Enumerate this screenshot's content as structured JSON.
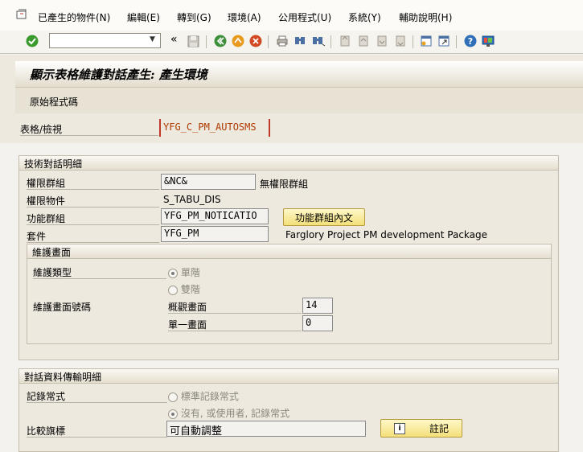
{
  "menu": {
    "items": [
      "已產生的物件(N)",
      "編輯(E)",
      "轉到(G)",
      "環境(A)",
      "公用程式(U)",
      "系統(Y)",
      "輔助說明(H)"
    ]
  },
  "toolbar": {
    "command_value": "",
    "back_label": "«",
    "icons": [
      "check-icon",
      "save-icon",
      "back-icon",
      "exit-icon",
      "cancel-icon",
      "print-icon",
      "find-icon",
      "find-next-icon",
      "first-page-icon",
      "prev-page-icon",
      "next-page-icon",
      "last-page-icon",
      "new-session-icon",
      "shortcut-icon",
      "help-icon",
      "layout-icon"
    ]
  },
  "header": {
    "title": "顯示表格維護對話產生: 產生環境",
    "source_button": "原始程式碼"
  },
  "table": {
    "label": "表格/檢視",
    "value": "YFG_C_PM_AUTOSMS"
  },
  "tech_group": {
    "title": "技術對話明細",
    "auth_group_label": "權限群組",
    "auth_group_value": "&NC&",
    "auth_group_text": "無權限群組",
    "auth_object_label": "權限物件",
    "auth_object_value": "S_TABU_DIS",
    "function_group_label": "功能群組",
    "function_group_value": "YFG_PM_NOTICATIO",
    "function_group_button": "功能群組內文",
    "package_label": "套件",
    "package_value": "YFG_PM",
    "package_text": "Farglory Project PM development Package"
  },
  "maint_screen": {
    "title": "維護畫面",
    "type_label": "維護類型",
    "single_label": "單階",
    "double_label": "雙階",
    "screen_no_label": "維護畫面號碼",
    "overview_label": "概觀畫面",
    "overview_value": "14",
    "single_screen_label": "單一畫面",
    "single_screen_value": "0"
  },
  "transport_group": {
    "title": "對話資料傳輸明細",
    "recording_label": "記錄常式",
    "standard_label": "標準記錄常式",
    "none_label": "沒有, 或使用者, 記錄常式",
    "compare_label": "比較旗標",
    "compare_value": "可自動調整",
    "note_button": "註記"
  },
  "colors": {
    "accent_button": "#f3df79",
    "required_marker": "#c0392b",
    "table_text": "#b03a00"
  }
}
